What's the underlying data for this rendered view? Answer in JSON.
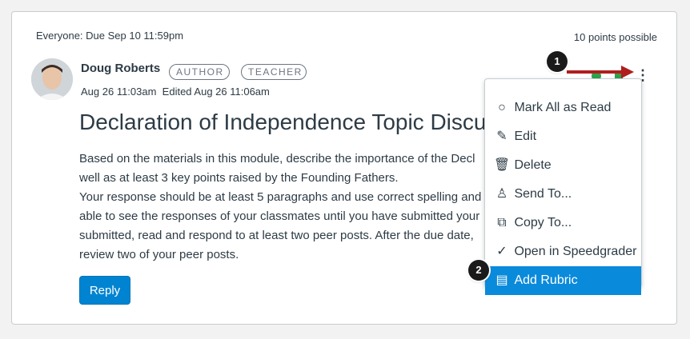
{
  "header": {
    "due_text": "Everyone: Due Sep 10 11:59pm",
    "points_text": "10 points possible"
  },
  "post": {
    "author_name": "Doug Roberts",
    "author_badge": "AUTHOR",
    "role_badge": "TEACHER",
    "timestamps": "Aug 26 11:03am  Edited Aug 26 11:06am",
    "title": "Declaration of Independence Topic Discuss",
    "body_lines": [
      "Based on the materials in this module, describe the importance of the Decl",
      "well as at least 3 key points raised by the Founding Fathers.",
      "Your response should be at least 5 paragraphs and use correct spelling and",
      "able to see the responses of your classmates until you have submitted your",
      "submitted, read and respond to at least two peer posts. After the due date,",
      "review two of your peer posts."
    ],
    "reply_label": "Reply"
  },
  "callouts": {
    "one": "1",
    "two": "2"
  },
  "menu": {
    "items": [
      {
        "label": "Mark All as Read",
        "icon": "circle-icon",
        "glyph": "○"
      },
      {
        "label": "Edit",
        "icon": "pencil-icon",
        "glyph": "✎"
      },
      {
        "label": "Delete",
        "icon": "trash-icon",
        "glyph": "🗑"
      },
      {
        "label": "Send To...",
        "icon": "user-icon",
        "glyph": "♙"
      },
      {
        "label": "Copy To...",
        "icon": "copy-icon",
        "glyph": "⧉"
      },
      {
        "label": "Open in Speedgrader",
        "icon": "speedgrader-icon",
        "glyph": "✓"
      },
      {
        "label": "Add Rubric",
        "icon": "rubric-icon",
        "glyph": "▤"
      }
    ],
    "selected_index": 6
  },
  "colors": {
    "accent": "#0084d1",
    "menu_highlight": "#0a8adb",
    "arrow": "#b01d1d",
    "status_green": "#2fa24e"
  }
}
